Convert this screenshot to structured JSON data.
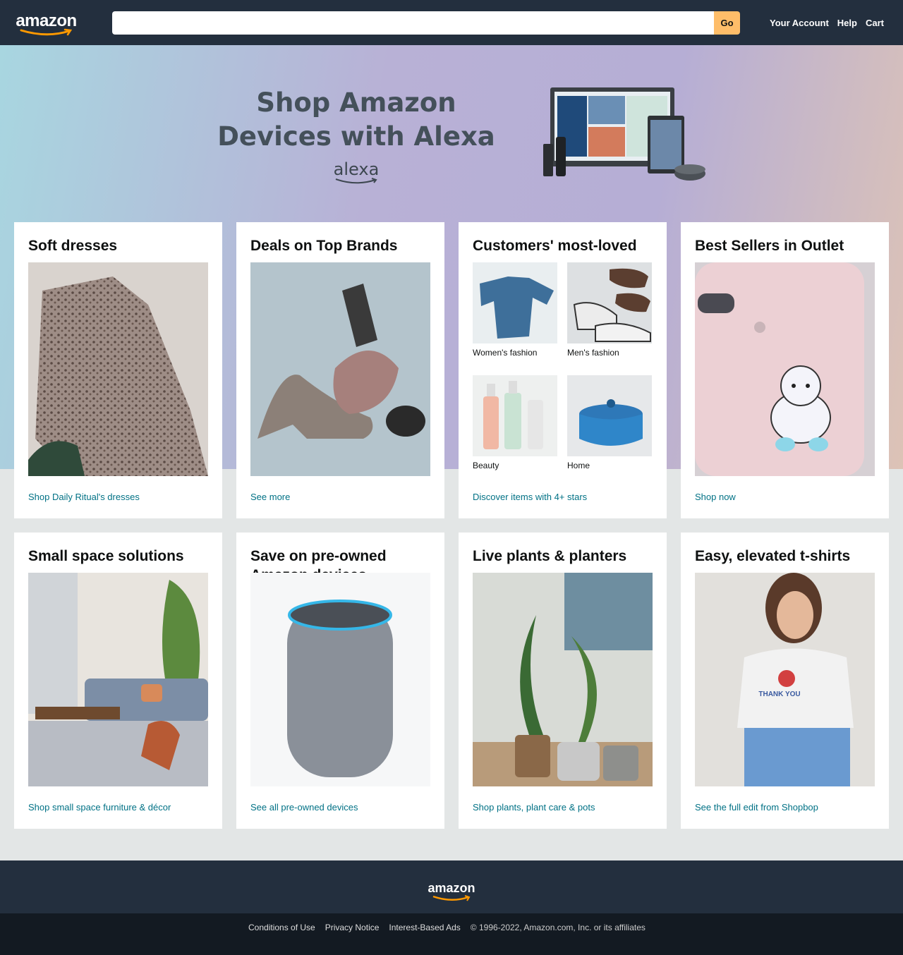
{
  "nav": {
    "logo_text": "amazon",
    "search_value": "",
    "search_placeholder": "",
    "go_label": "Go",
    "links": [
      "Your Account",
      "Help",
      "Cart"
    ]
  },
  "hero": {
    "title": "Shop Amazon Devices with Alexa",
    "brand": "alexa"
  },
  "row1": [
    {
      "title": "Soft dresses",
      "link": "Shop Daily Ritual's dresses",
      "image": "leopard-print-dress-photo"
    },
    {
      "title": "Deals on Top Brands",
      "link": "See more",
      "image": "heels-and-hair-dryer-photo"
    },
    {
      "title": "Customers' most-loved",
      "link": "Discover items with 4+ stars",
      "tiles": [
        {
          "label": "Women's fashion",
          "image": "blue-top-photo"
        },
        {
          "label": "Men's fashion",
          "image": "sneakers-sandals-photo"
        },
        {
          "label": "Beauty",
          "image": "spray-bottles-photo"
        },
        {
          "label": "Home",
          "image": "blue-dutch-oven-photo"
        }
      ]
    },
    {
      "title": "Best Sellers in Outlet",
      "link": "Shop now",
      "image": "unicorn-phone-case-photo"
    }
  ],
  "row2": [
    {
      "title": "Small space solutions",
      "link": "Shop small space furniture & décor",
      "image": "living-room-photo"
    },
    {
      "title": "Save on pre-owned Amazon devices",
      "link": "See all pre-owned devices",
      "image": "echo-speaker-photo"
    },
    {
      "title": "Live plants & planters",
      "link": "Shop plants, plant care & pots",
      "image": "potted-plants-photo"
    },
    {
      "title": "Easy, elevated t-shirts",
      "link": "See the full edit from Shopbop",
      "image": "woman-tshirt-photo",
      "shirt_text": "THANK YOU"
    }
  ],
  "footer": {
    "logo_text": "amazon",
    "links": [
      "Conditions of Use",
      "Privacy Notice",
      "Interest-Based Ads"
    ],
    "copyright": "© 1996-2022, Amazon.com, Inc. or its affiliates"
  },
  "colors": {
    "nav_bg": "#232f3e",
    "footer_bottom": "#131a22",
    "link": "#007185",
    "go_button": "#febd69"
  }
}
